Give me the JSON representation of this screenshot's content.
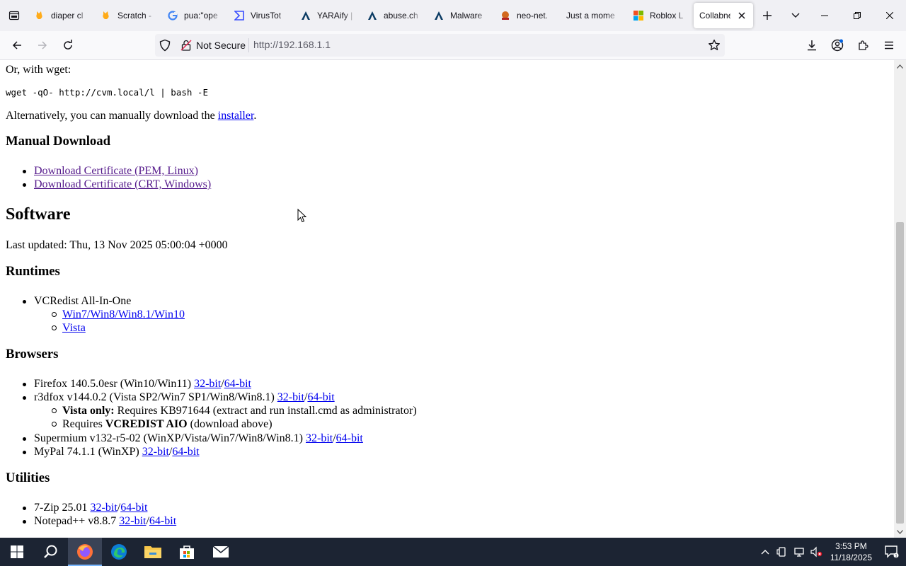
{
  "tabs": [
    {
      "title": "diaper cl",
      "icon": "scratch-cat-icon"
    },
    {
      "title": "Scratch -",
      "icon": "scratch-cat-icon"
    },
    {
      "title": "pua:\"ope",
      "icon": "google-icon"
    },
    {
      "title": "VirusTot",
      "icon": "virustotal-icon"
    },
    {
      "title": "YARAify |",
      "icon": "yaraify-icon"
    },
    {
      "title": "abuse.ch",
      "icon": "abuse-icon"
    },
    {
      "title": "Malware",
      "icon": "malware-icon"
    },
    {
      "title": "neo-net.",
      "icon": "neonet-icon"
    },
    {
      "title": "Just a mome",
      "icon": "loading-icon"
    },
    {
      "title": "Roblox L",
      "icon": "microsoft-icon"
    },
    {
      "title": "Collabnet",
      "icon": "none",
      "active": true
    }
  ],
  "navbar": {
    "secure_label": "Not Secure",
    "url": "http://192.168.1.1"
  },
  "content": {
    "wget_intro": "Or, with wget:",
    "wget_cmd": "wget -qO- http://cvm.local/l | bash -E",
    "alt_text": "Alternatively, you can manually download the ",
    "installer_link": "installer",
    "period": ".",
    "manual_heading": "Manual Download",
    "cert_pem": "Download Certificate (PEM, Linux)",
    "cert_crt": "Download Certificate (CRT, Windows)",
    "software_heading": "Software",
    "last_updated": "Last updated: Thu, 13 Nov 2025 05:00:04 +0000",
    "runtimes_heading": "Runtimes",
    "vcredist": "VCRedist All-In-One",
    "vc_win": "Win7/Win8/Win8.1/Win10",
    "vc_vista": "Vista",
    "browsers_heading": "Browsers",
    "firefox": "Firefox 140.5.0esr (Win10/Win11) ",
    "r3dfox": "r3dfox v144.0.2 (Vista SP2/Win7 SP1/Win8/Win8.1) ",
    "vista_only_bold": "Vista only:",
    "vista_only_rest": " Requires KB971644 (extract and run install.cmd as administrator)",
    "requires": "Requires ",
    "requires_bold": "VCREDIST AIO",
    "requires_rest": " (download above)",
    "supermium": "Supermium v132-r5-02 (WinXP/Vista/Win7/Win8/Win8.1) ",
    "mypal": "MyPal 74.1.1 (WinXP) ",
    "utilities_heading": "Utilities",
    "sevenzip": "7-Zip 25.01 ",
    "notepad": "Notepad++ v8.8.7 ",
    "bit32": "32-bit",
    "bit64": "64-bit",
    "slash": "/"
  },
  "taskbar": {
    "time": "3:53 PM",
    "date": "11/18/2025"
  },
  "colors": {
    "link": "#0000ee",
    "visited": "#551a8b",
    "taskbar": "#1c2433"
  }
}
